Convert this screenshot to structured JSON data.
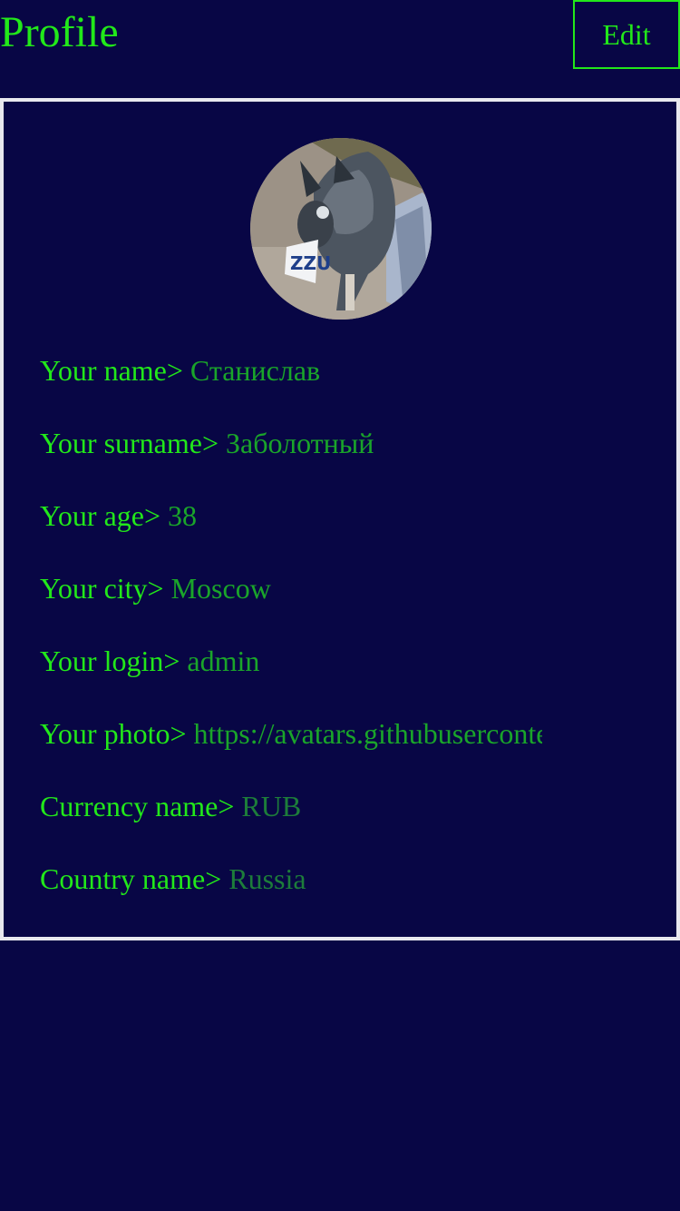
{
  "header": {
    "title": "Profile",
    "edit_label": "Edit"
  },
  "colors": {
    "background": "#080645",
    "accent": "#22e81a",
    "value": "#1aa52a",
    "card_border": "#e8e8ee"
  },
  "profile": {
    "avatar_icon": "dog-photo",
    "fields": [
      {
        "label": "Your name>",
        "value": "Станислав"
      },
      {
        "label": "Your surname>",
        "value": "Заболотный"
      },
      {
        "label": "Your age>",
        "value": "38"
      },
      {
        "label": "Your city>",
        "value": "Moscow"
      },
      {
        "label": "Your login>",
        "value": "admin"
      },
      {
        "label": "Your photo>",
        "value": "https://avatars.githubuserconte"
      },
      {
        "label": "Currency name>",
        "value": "RUB"
      },
      {
        "label": "Country name>",
        "value": "Russia"
      }
    ]
  }
}
